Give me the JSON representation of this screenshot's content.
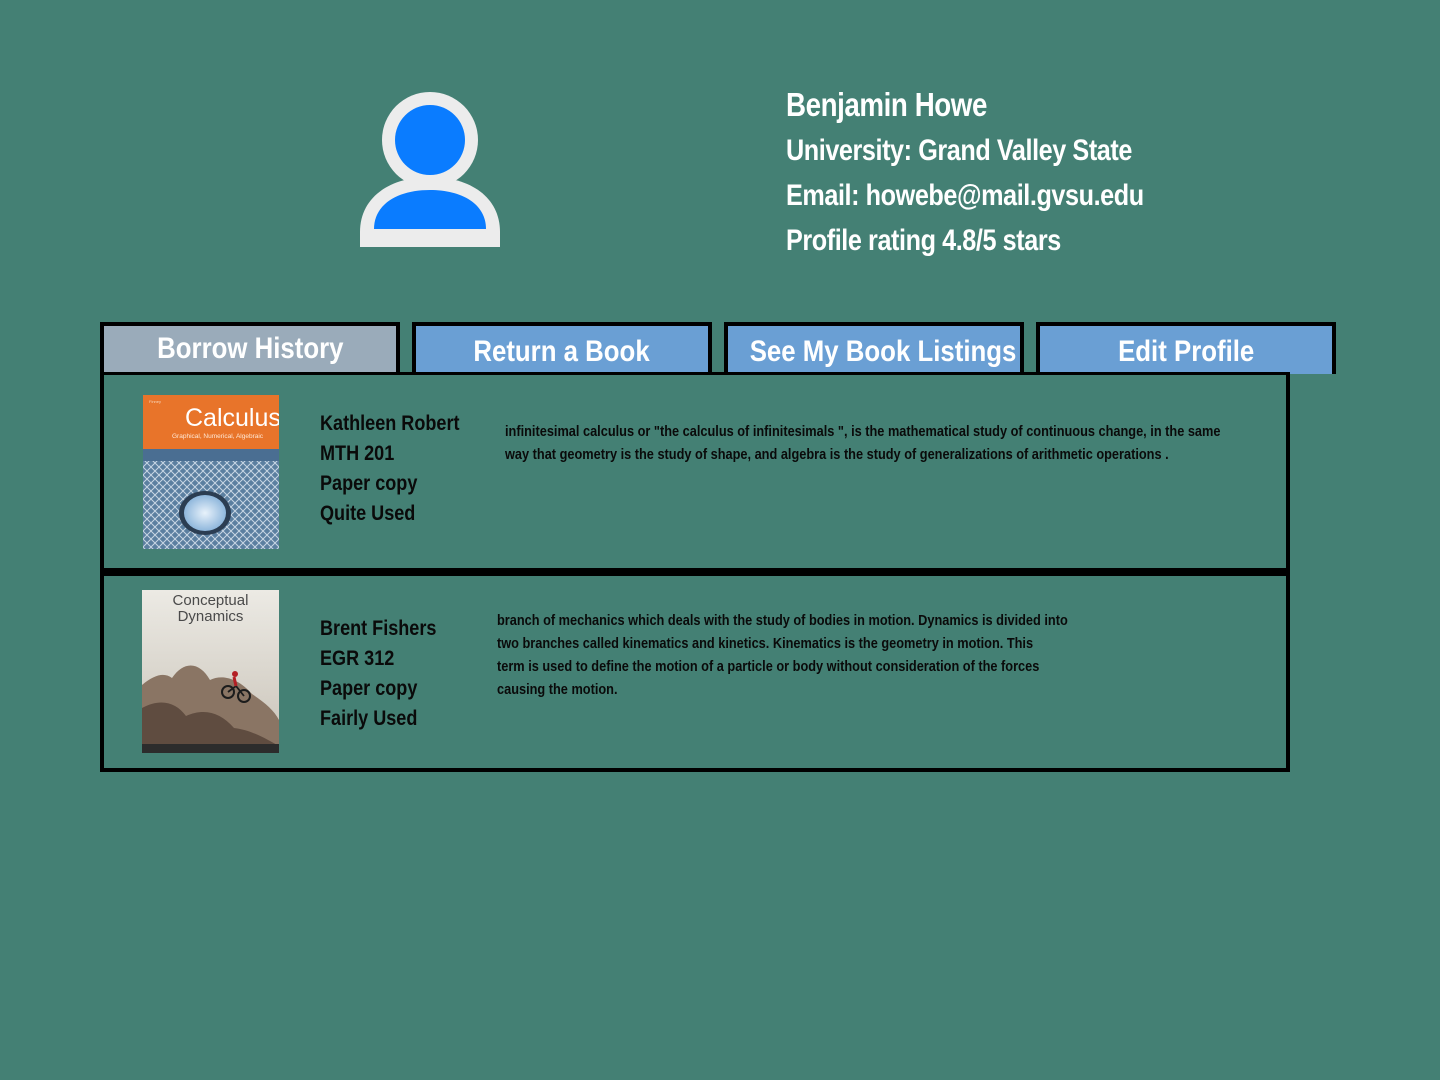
{
  "profile": {
    "name": "Benjamin Howe",
    "university": "University: Grand Valley State",
    "email": "Email: howebe@mail.gvsu.edu",
    "rating": "Profile rating 4.8/5 stars"
  },
  "tabs": [
    {
      "label": "Borrow History",
      "active": true
    },
    {
      "label": "Return a Book",
      "active": false
    },
    {
      "label": "See My Book Listings",
      "active": false
    },
    {
      "label": "Edit Profile",
      "active": false
    }
  ],
  "books": [
    {
      "cover_title": "Calculus",
      "cover_subtitle": "Graphical, Numerical, Algebraic",
      "owner": "Kathleen Robert",
      "course": "MTH 201",
      "format": "Paper copy",
      "condition": "Quite Used",
      "description": [
        "infinitesimal calculus or \"the calculus of infinitesimals \", is the mathematical study of continuous change, in the same",
        " way that geometry is the study of shape, and algebra is the study of generalizations of arithmetic operations ."
      ]
    },
    {
      "cover_title_1": "Conceptual",
      "cover_title_2": "Dynamics",
      "owner": "Brent Fishers",
      "course": "EGR 312",
      "format": "Paper copy",
      "condition": "Fairly Used",
      "description": [
        " branch of mechanics which deals with the study of bodies in motion. Dynamics is divided into",
        " two branches called kinematics and kinetics. Kinematics is the geometry in motion. This",
        "term is used to define the motion of a particle or body without consideration of the forces",
        "causing the motion."
      ]
    }
  ],
  "colors": {
    "background": "#448074",
    "tab_active": "#9aabba",
    "tab_inactive": "#6a9fd4",
    "avatar_blue": "#0a7cff",
    "avatar_ring": "#ececec"
  },
  "icons": {
    "avatar": "user-avatar-icon"
  }
}
